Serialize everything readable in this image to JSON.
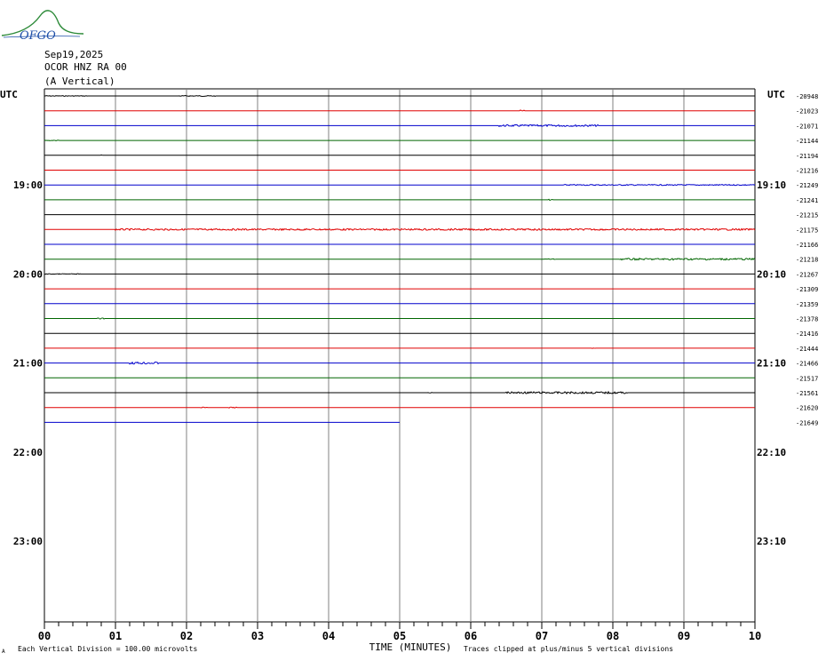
{
  "logo": {
    "text": "OFGO",
    "color_text": "#1e4fa8",
    "color_arc": "#2e8b3a"
  },
  "header": {
    "date": "Sep19,2025",
    "station": "OCOR HNZ RA 00",
    "component": "(A Vertical)"
  },
  "chart_data": {
    "type": "line",
    "title": "OCOR HNZ RA 00",
    "xlabel": "TIME (MINUTES)",
    "ylabel": "",
    "xlim": [
      0,
      10
    ],
    "x_ticks": [
      "00",
      "01",
      "02",
      "03",
      "04",
      "05",
      "06",
      "07",
      "08",
      "09",
      "10"
    ],
    "left_axis_label": "UTC",
    "right_axis_label": "UTC",
    "left_hour_labels": [
      {
        "text": "19:00",
        "row": 6
      },
      {
        "text": "20:00",
        "row": 12
      },
      {
        "text": "21:00",
        "row": 18
      },
      {
        "text": "22:00",
        "row": 24
      },
      {
        "text": "23:00",
        "row": 30
      }
    ],
    "right_hour_labels": [
      {
        "text": "19:10",
        "row": 6
      },
      {
        "text": "20:10",
        "row": 12
      },
      {
        "text": "21:10",
        "row": 18
      },
      {
        "text": "22:10",
        "row": 24
      },
      {
        "text": "23:10",
        "row": 30
      }
    ],
    "trace_colors": [
      "#000000",
      "#e00000",
      "#0000cc",
      "#006600"
    ],
    "traces": [
      {
        "offset": -20948,
        "end_minute": 10,
        "activity": [
          [
            0.0,
            0.6,
            0.4
          ],
          [
            1.9,
            2.4,
            0.5
          ]
        ]
      },
      {
        "offset": -21023,
        "end_minute": 10,
        "activity": [
          [
            6.7,
            6.75,
            0.8
          ]
        ]
      },
      {
        "offset": -21071,
        "end_minute": 10,
        "activity": [
          [
            6.4,
            7.8,
            1.0
          ]
        ]
      },
      {
        "offset": -21144,
        "end_minute": 10,
        "activity": [
          [
            0.0,
            0.2,
            0.4
          ]
        ]
      },
      {
        "offset": -21194,
        "end_minute": 10,
        "activity": [
          [
            0.78,
            0.82,
            0.8
          ]
        ]
      },
      {
        "offset": -21216,
        "end_minute": 10,
        "activity": []
      },
      {
        "offset": -21249,
        "end_minute": 10,
        "activity": [
          [
            7.3,
            10.0,
            0.6
          ]
        ]
      },
      {
        "offset": -21241,
        "end_minute": 10,
        "activity": [
          [
            7.1,
            7.15,
            0.6
          ]
        ]
      },
      {
        "offset": -21215,
        "end_minute": 10,
        "activity": []
      },
      {
        "offset": -21175,
        "end_minute": 10,
        "activity": [
          [
            1.0,
            10.0,
            0.9
          ]
        ]
      },
      {
        "offset": -21166,
        "end_minute": 10,
        "activity": []
      },
      {
        "offset": -21218,
        "end_minute": 10,
        "activity": [
          [
            7.0,
            7.2,
            0.4
          ],
          [
            8.1,
            10.0,
            1.0
          ]
        ]
      },
      {
        "offset": -21267,
        "end_minute": 10,
        "activity": [
          [
            0.0,
            0.5,
            0.4
          ]
        ]
      },
      {
        "offset": -21309,
        "end_minute": 10,
        "activity": []
      },
      {
        "offset": -21359,
        "end_minute": 10,
        "activity": []
      },
      {
        "offset": -21378,
        "end_minute": 10,
        "activity": [
          [
            0.75,
            0.85,
            0.6
          ]
        ]
      },
      {
        "offset": -21416,
        "end_minute": 10,
        "activity": []
      },
      {
        "offset": -21444,
        "end_minute": 10,
        "activity": [
          [
            7.7,
            7.75,
            0.6
          ]
        ]
      },
      {
        "offset": -21466,
        "end_minute": 10,
        "activity": [
          [
            1.2,
            1.6,
            1.2
          ]
        ]
      },
      {
        "offset": -21517,
        "end_minute": 10,
        "activity": []
      },
      {
        "offset": -21561,
        "end_minute": 10,
        "activity": [
          [
            5.4,
            5.45,
            0.5
          ],
          [
            6.5,
            8.2,
            1.1
          ]
        ]
      },
      {
        "offset": -21620,
        "end_minute": 10,
        "activity": [
          [
            2.2,
            2.3,
            0.5
          ],
          [
            2.6,
            2.7,
            0.6
          ]
        ]
      },
      {
        "offset": -21649,
        "end_minute": 5,
        "activity": []
      }
    ],
    "total_rows": 36,
    "grid": true
  },
  "footer": {
    "left_note": "Each Vertical Division =  100.00 microvolts",
    "right_note": "Traces clipped at plus/minus 5 vertical divisions",
    "corner_mark": "A"
  }
}
